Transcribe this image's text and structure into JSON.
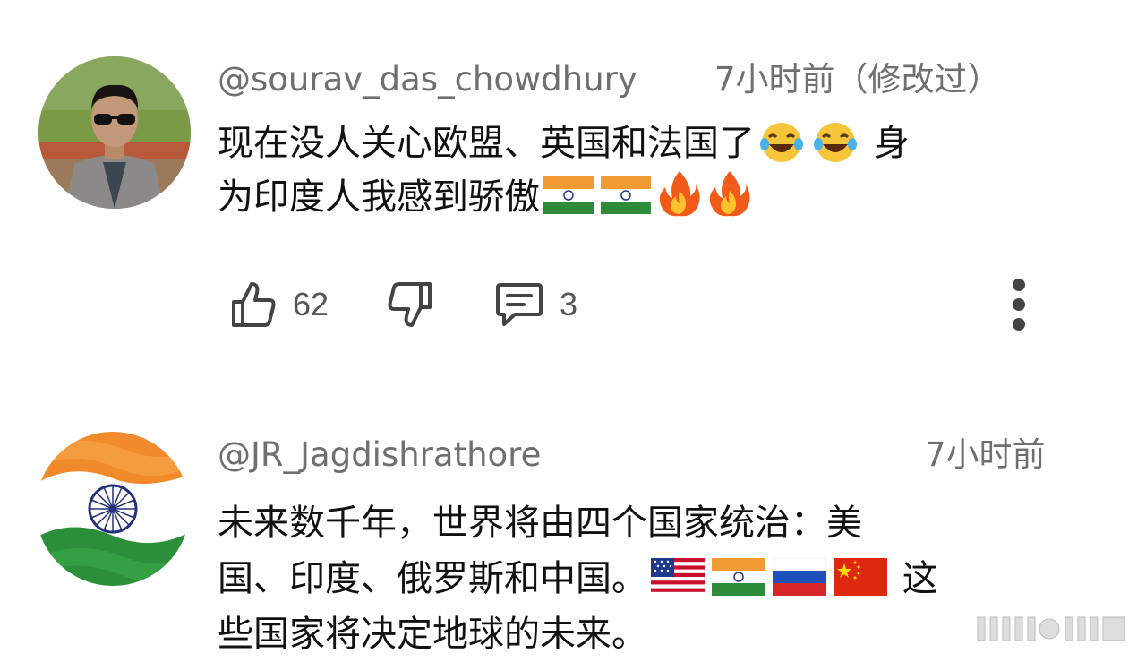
{
  "comments": [
    {
      "username": "@sourav_das_chowdhury",
      "timestamp": "7小时前（修改过）",
      "avatar_icon": "user-photo-avatar",
      "lines": [
        {
          "text": "现在没人关心欧盟、英国和法国了",
          "tail": " 身"
        },
        {
          "text": "为印度人我感到骄傲"
        }
      ],
      "likes": "62",
      "replies": "3"
    },
    {
      "username": "@JR_Jagdishrathore",
      "timestamp": "7小时前",
      "avatar_icon": "india-flag-avatar",
      "lines": [
        {
          "text": "未来数千年，世界将由四个国家统治：美"
        },
        {
          "text": "国、印度、俄罗斯和中国。",
          "tail": " 这"
        },
        {
          "text": "些国家将决定地球的未来。"
        }
      ]
    }
  ],
  "icons": {
    "like": "thumbs-up-icon",
    "dislike": "thumbs-down-icon",
    "reply": "comment-icon",
    "more": "more-vertical-icon"
  },
  "colors": {
    "meta_text": "#6f6f6f",
    "body_text": "#111111",
    "icon": "#444444"
  }
}
